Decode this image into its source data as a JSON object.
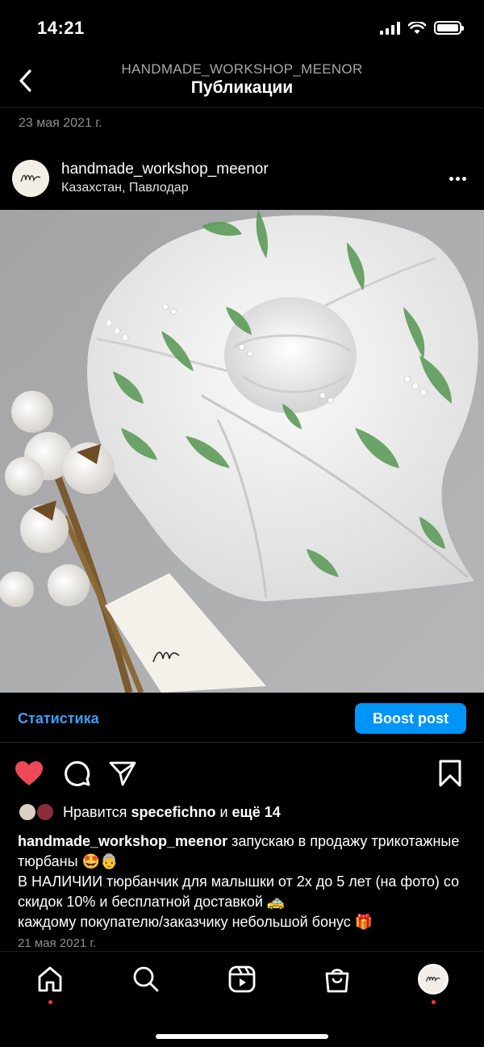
{
  "status_bar": {
    "time": "14:21"
  },
  "header": {
    "subtitle": "HANDMADE_WORKSHOP_MEENOR",
    "title": "Публикации"
  },
  "top_date": "23 мая 2021 г.",
  "post": {
    "username": "handmade_workshop_meenor",
    "location": "Казахстан, Павлодар",
    "insights_label": "Статистика",
    "boost_label": "Boost post",
    "likes": {
      "prefix": "Нравится ",
      "user": "specefichno",
      "middle": " и ",
      "others": "ещё 14"
    },
    "caption": {
      "username": "handmade_workshop_meenor",
      "line1": " запускаю в продажу трикотажные тюрбаны 🤩👵",
      "line2": "В НАЛИЧИИ тюрбанчик для малышки от 2х до 5 лет (на фото) со скидок 10% и бесплатной доставкой 🚕",
      "line3": "каждому покупателю/заказчику небольшой бонус 🎁"
    },
    "date": "21 мая 2021 г."
  },
  "colors": {
    "like_red": "#ed4956",
    "link_blue": "#3f9ef7",
    "boost_blue": "#0095f6"
  },
  "icons": {
    "back": "chevron-left-icon",
    "like": "heart-filled-icon",
    "comment": "comment-bubble-icon",
    "share": "paper-plane-icon",
    "save": "bookmark-icon",
    "home": "home-icon",
    "search": "search-icon",
    "reels": "reels-icon",
    "shop": "shopping-bag-icon"
  }
}
